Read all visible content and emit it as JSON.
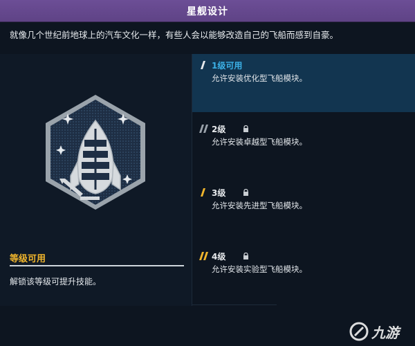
{
  "header": {
    "title": "星舰设计"
  },
  "description": "就像几个世纪前地球上的汽车文化一样，有些人会以能够改造自己的飞船而感到自豪。",
  "skill": {
    "name": "等级可用",
    "description": "解锁该等级可提升技能。",
    "icon": "spaceship-design-emblem-icon"
  },
  "tiers": [
    {
      "title": "1级可用",
      "description": "允许安装优化型飞船模块。",
      "locked": false,
      "active": true
    },
    {
      "title": "2级",
      "description": "允许安装卓越型飞船模块。",
      "locked": true,
      "active": false
    },
    {
      "title": "3级",
      "description": "允许安装先进型飞船模块。",
      "locked": true,
      "active": false
    },
    {
      "title": "4级",
      "description": "允许安装实验型飞船模块。",
      "locked": true,
      "active": false
    }
  ],
  "watermark": {
    "text": "九游"
  },
  "colors": {
    "title_bar": "#5f4386",
    "accent_orange": "#f0b52c",
    "accent_blue": "#3bb0e6",
    "active_row": "#123550"
  }
}
